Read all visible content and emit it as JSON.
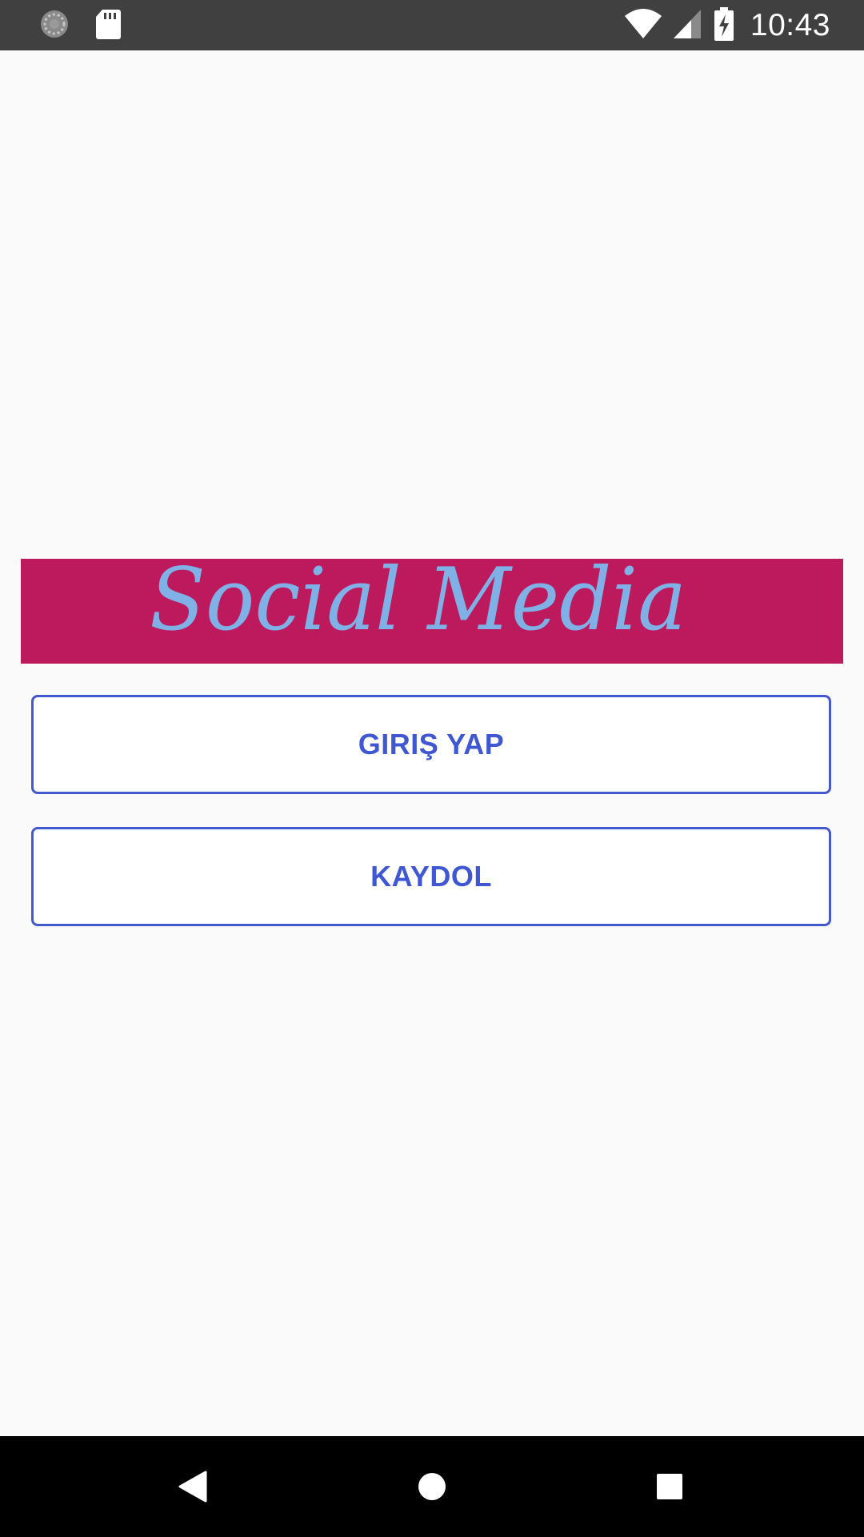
{
  "status_bar": {
    "time": "10:43",
    "icons": [
      "sync-icon",
      "sd-card-icon",
      "wifi-icon",
      "signal-icon",
      "battery-charging-icon"
    ],
    "background_color": "#404040"
  },
  "banner": {
    "text": "Social Media",
    "background_color": "#bc1a5c",
    "text_color": "#7fb0e6"
  },
  "buttons": {
    "login_label": "GIRIŞ YAP",
    "signup_label": "KAYDOL",
    "accent_color": "#3f57d1"
  },
  "nav_bar": {
    "icons": [
      "back-icon",
      "home-icon",
      "recents-icon"
    ]
  }
}
